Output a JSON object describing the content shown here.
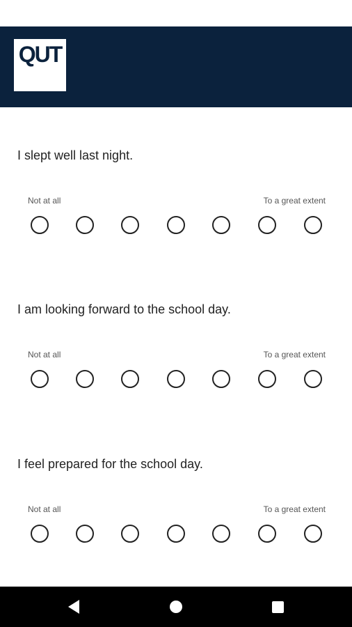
{
  "header": {
    "logo_text": "QUT"
  },
  "questions": [
    {
      "text": "I slept well last night.",
      "min_label": "Not at all",
      "max_label": "To a great extent",
      "options": 7,
      "selected": null
    },
    {
      "text": "I am looking forward to the school day.",
      "min_label": "Not at all",
      "max_label": "To a great extent",
      "options": 7,
      "selected": null
    },
    {
      "text": "I feel prepared for the school day.",
      "min_label": "Not at all",
      "max_label": "To a great extent",
      "options": 7,
      "selected": null
    }
  ],
  "nav": {
    "icons": [
      "back-icon",
      "home-icon",
      "recent-apps-icon"
    ]
  },
  "colors": {
    "header_bg": "#0b223d",
    "nav_bg": "#000000"
  }
}
